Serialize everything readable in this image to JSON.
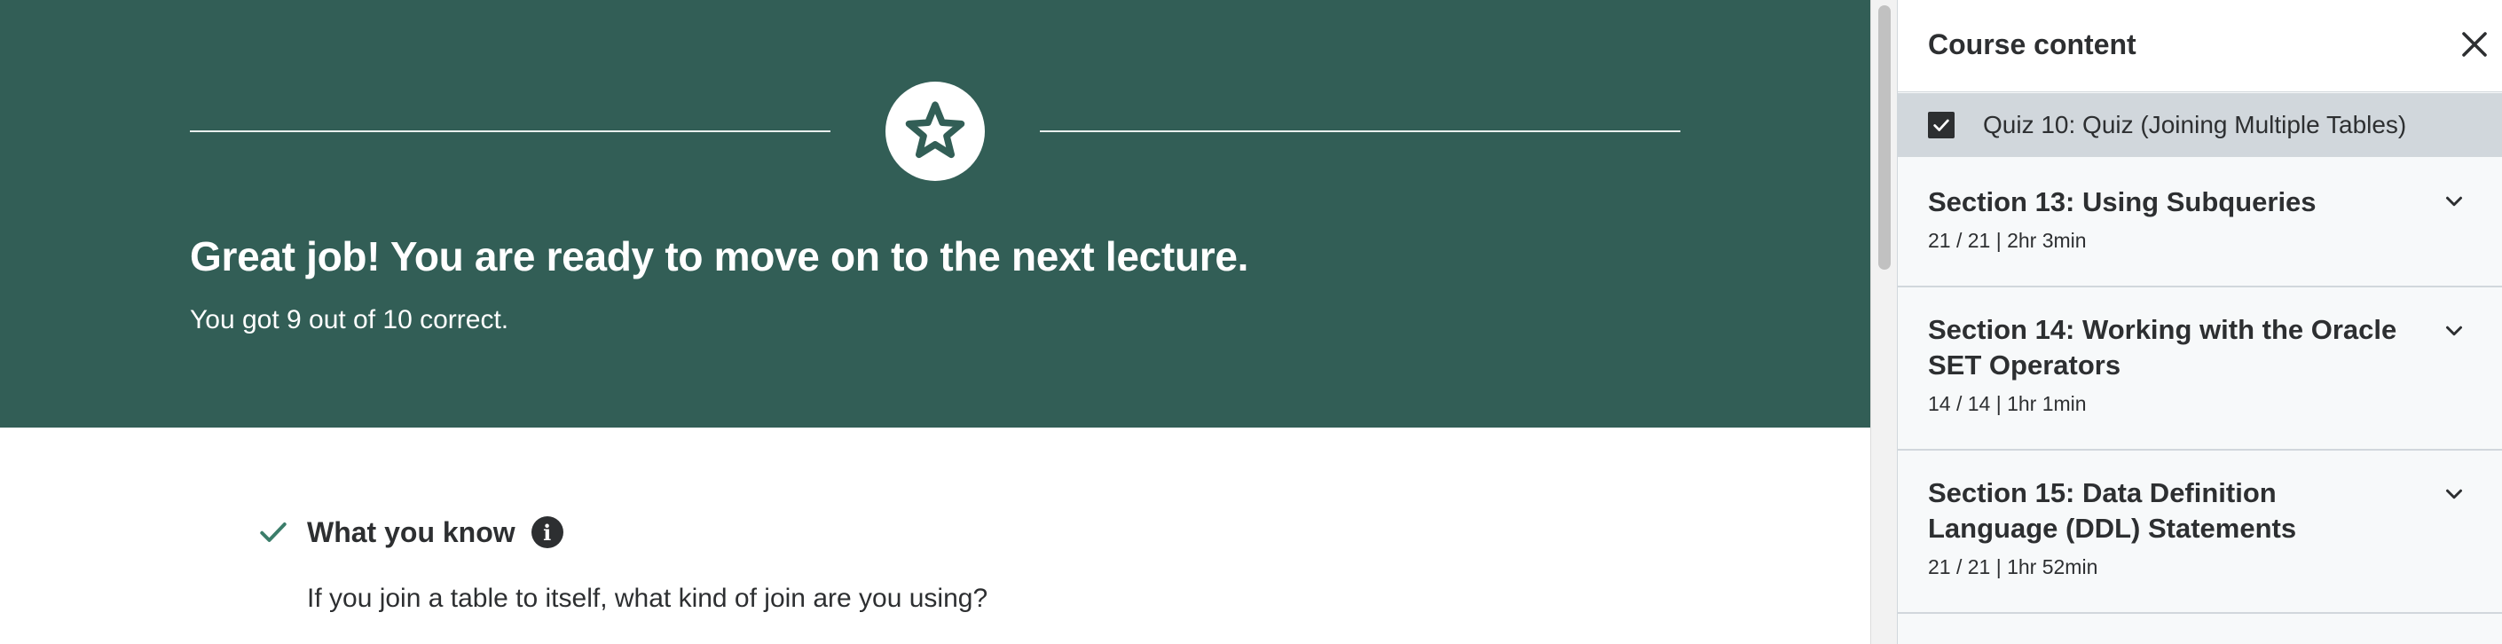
{
  "hero": {
    "title": "Great job! You are ready to move on to the next lecture.",
    "subtitle": "You got 9 out of 10 correct.",
    "badge_icon": "star-icon",
    "background": "#325e56"
  },
  "result": {
    "section_label": "What you know",
    "check_icon": "check-icon",
    "info_icon": "info-icon",
    "info_glyph": "i",
    "question": "If you join a table to itself, what kind of join are you using?",
    "check_color": "#3b7d6a"
  },
  "sidebar": {
    "title": "Course content",
    "close_icon": "close-icon",
    "current_item": {
      "label": "Quiz 10: Quiz (Joining Multiple Tables)",
      "completed": true
    },
    "sections": [
      {
        "title": "Section 13: Using Subqueries",
        "meta": "21 / 21 | 2hr 3min"
      },
      {
        "title": "Section 14: Working with the Oracle SET Operators",
        "meta": "14 / 14 | 1hr 1min"
      },
      {
        "title": "Section 15: Data Definition Language (DDL) Statements",
        "meta": "21 / 21 | 1hr 52min"
      }
    ]
  }
}
